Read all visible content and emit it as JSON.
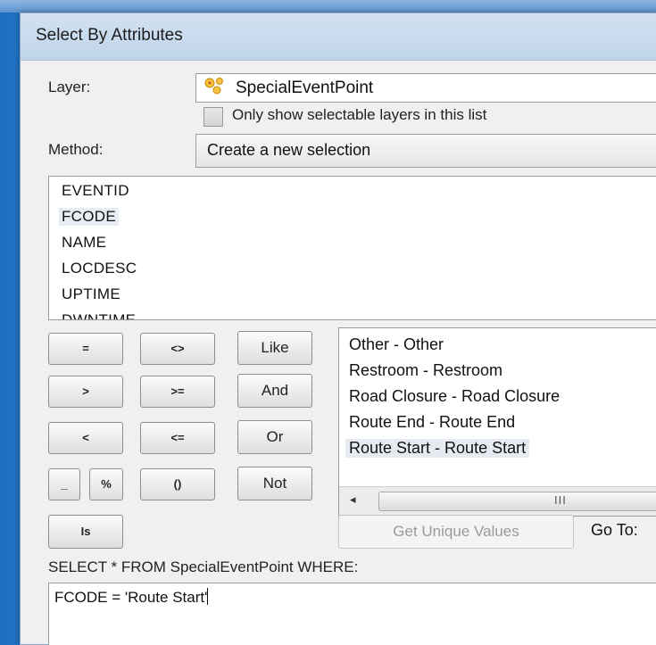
{
  "window": {
    "title": "Select By Attributes"
  },
  "layer": {
    "label": "Layer:",
    "value": "SpecialEventPoint",
    "icon": "point-layer-icon"
  },
  "selectable_only": {
    "label": "Only show selectable layers in this list",
    "checked": false
  },
  "method": {
    "label": "Method:",
    "value": "Create a new selection"
  },
  "fields": {
    "items": [
      "EVENTID",
      "FCODE",
      "NAME",
      "LOCDESC",
      "UPTIME",
      "DWNTIME"
    ],
    "selected": "FCODE"
  },
  "operators": {
    "eq": "=",
    "ne": "<>",
    "like": "Like",
    "gt": ">",
    "ge": ">=",
    "and": "And",
    "lt": "<",
    "le": "<=",
    "or": "Or",
    "underscore": "_",
    "percent": "%",
    "parens": "()",
    "not": "Not",
    "is": "Is"
  },
  "unique_values": {
    "items": [
      "Other - Other",
      "Restroom - Restroom",
      "Road Closure - Road Closure",
      "Route End - Route End",
      "Route Start - Route Start"
    ],
    "selected": "Route Start - Route Start"
  },
  "scrollbar": {
    "left_arrow": "◂",
    "grip": "III"
  },
  "get_unique_values": {
    "label": "Get Unique Values",
    "enabled": false
  },
  "goto": {
    "label": "Go To:"
  },
  "select_from": {
    "label": "SELECT * FROM SpecialEventPoint WHERE:"
  },
  "expression": {
    "value": "FCODE = 'Route Start'"
  },
  "colors": {
    "titlebar": "#c9dcef",
    "desktop": "#2a7fd2",
    "dialog": "#f0f0f0"
  }
}
